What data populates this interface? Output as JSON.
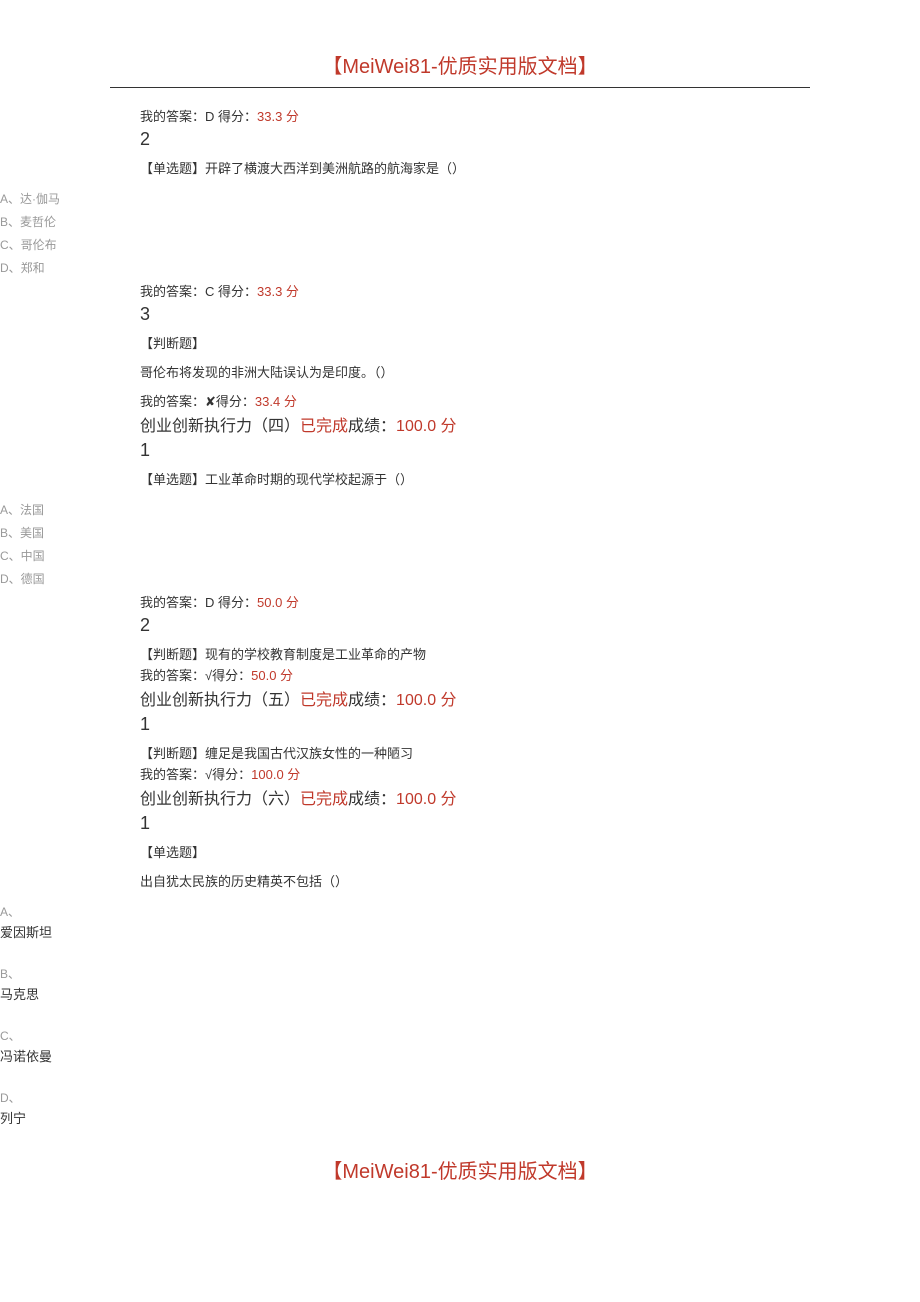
{
  "header": "【MeiWei81-优质实用版文档】",
  "q1": {
    "answer_prefix": "我的答案：D 得分：",
    "score": "33.3 分"
  },
  "q2": {
    "num": "2",
    "text": "【单选题】开辟了横渡大西洋到美洲航路的航海家是（）",
    "opts": {
      "a": "A、达·伽马",
      "b": "B、麦哲伦",
      "c": "C、哥伦布",
      "d": "D、郑和"
    },
    "answer_prefix": "我的答案：C 得分：",
    "score": "33.3 分"
  },
  "q3": {
    "num": "3",
    "type": "【判断题】",
    "text": "哥伦布将发现的非洲大陆误认为是印度。（）",
    "answer_prefix": "我的答案：✘得分：",
    "score": "33.4 分"
  },
  "sec4": {
    "title_black": "创业创新执行力（四）",
    "completed": "已完成",
    "score_label": "成绩：",
    "score_value": "100.0 分",
    "q1": {
      "num": "1",
      "text": "【单选题】工业革命时期的现代学校起源于（）",
      "opts": {
        "a": "A、法国",
        "b": "B、美国",
        "c": "C、中国",
        "d": "D、德国"
      },
      "answer_prefix": "我的答案：D 得分：",
      "score": "50.0 分"
    },
    "q2": {
      "num": "2",
      "text": "【判断题】现有的学校教育制度是工业革命的产物",
      "answer_prefix": "我的答案：√得分：",
      "score": "50.0 分"
    }
  },
  "sec5": {
    "title_black": "创业创新执行力（五）",
    "completed": "已完成",
    "score_label": "成绩：",
    "score_value": "100.0 分",
    "q1": {
      "num": "1",
      "text": "【判断题】缠足是我国古代汉族女性的一种陋习",
      "answer_prefix": "我的答案：√得分：",
      "score": "100.0 分"
    }
  },
  "sec6": {
    "title_black": "创业创新执行力（六）",
    "completed": "已完成",
    "score_label": "成绩：",
    "score_value": "100.0 分",
    "q1": {
      "num": "1",
      "type": "【单选题】",
      "text": "出自犹太民族的历史精英不包括（）",
      "opts_letter": {
        "a": "A、",
        "b": "B、",
        "c": "C、",
        "d": "D、"
      },
      "opts_text": {
        "a": "爱因斯坦",
        "b": "马克思",
        "c": "冯诺依曼",
        "d": "列宁"
      }
    }
  },
  "footer": "【MeiWei81-优质实用版文档】"
}
